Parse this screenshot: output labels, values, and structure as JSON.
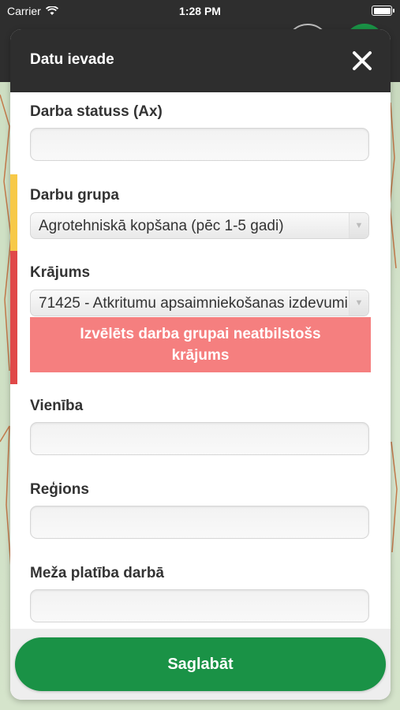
{
  "status_bar": {
    "carrier": "Carrier",
    "time": "1:28 PM"
  },
  "modal": {
    "title": "Datu ievade"
  },
  "fields": {
    "darba_statuss": {
      "label": "Darba statuss (Ax)",
      "value": ""
    },
    "darbu_grupa": {
      "label": "Darbu grupa",
      "value": "Agrotehniskā kopšana (pēc 1-5 gadi)",
      "marker_color": "#f7c948"
    },
    "krajums": {
      "label": "Krājums",
      "value": "71425 - Atkritumu apsaimniekošanas izdevumi",
      "marker_color": "#e04848",
      "error": "Izvēlēts darba grupai neatbilstošs krājums"
    },
    "vieniba": {
      "label": "Vienība",
      "value": ""
    },
    "regions": {
      "label": "Reģions",
      "value": ""
    },
    "meza_platiba": {
      "label": "Meža platība darbā",
      "value": ""
    }
  },
  "footer": {
    "save_label": "Saglabāt"
  },
  "colors": {
    "header": "#2e2e2e",
    "save": "#1a9246",
    "error": "#f57f7f"
  }
}
